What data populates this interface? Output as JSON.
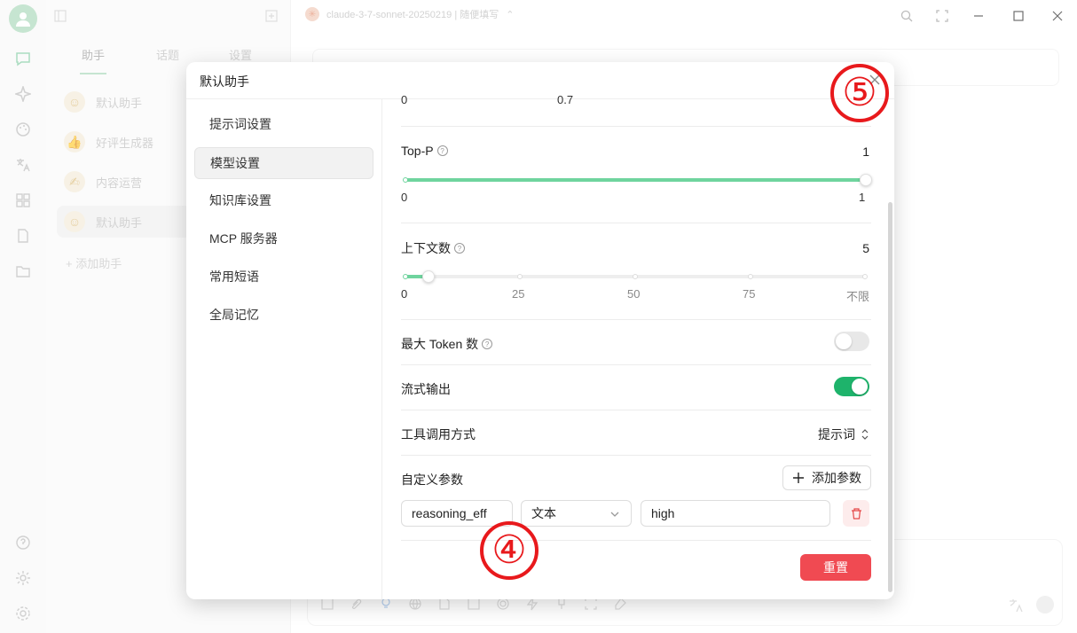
{
  "sidebar": {
    "tabs": [
      "助手",
      "话题",
      "设置"
    ],
    "assistants": [
      {
        "label": "默认助手",
        "emoji": "☺"
      },
      {
        "label": "好评生成器",
        "emoji": "👍"
      },
      {
        "label": "内容运营",
        "emoji": "✍"
      },
      {
        "label": "默认助手",
        "emoji": "☺"
      }
    ],
    "add_label": "+ 添加助手"
  },
  "topbar": {
    "model_label": "claude-3-7-sonnet-20250219 | 随便填写"
  },
  "modal": {
    "title": "默认助手",
    "menu": [
      {
        "label": "提示词设置",
        "active": false
      },
      {
        "label": "模型设置",
        "active": true
      },
      {
        "label": "知识库设置",
        "active": false
      },
      {
        "label": "MCP 服务器",
        "active": false
      },
      {
        "label": "常用短语",
        "active": false
      },
      {
        "label": "全局记忆",
        "active": false
      }
    ],
    "temperature": {
      "tick_min": "0",
      "tick_mid": "0.7"
    },
    "top_p": {
      "label": "Top-P",
      "value": 1,
      "tick_min": "0",
      "tick_max": "1"
    },
    "context": {
      "label": "上下文数",
      "value": 5,
      "ticks": [
        "0",
        "25",
        "50",
        "75",
        "不限"
      ]
    },
    "max_token": {
      "label": "最大 Token 数",
      "enabled": false
    },
    "stream": {
      "label": "流式输出",
      "enabled": true
    },
    "tool_mode": {
      "label": "工具调用方式",
      "value": "提示词"
    },
    "custom_params": {
      "label": "自定义参数",
      "add_label": "添加参数",
      "name": "reasoning_eff",
      "type": "文本",
      "value": "high"
    },
    "reset_label": "重置"
  },
  "annotations": [
    "⑤",
    "④"
  ],
  "colors": {
    "accent_green": "#1eb36b",
    "slider_green": "#6fd49e",
    "danger_red": "#f04a52",
    "annotation_red": "#e8191c"
  }
}
